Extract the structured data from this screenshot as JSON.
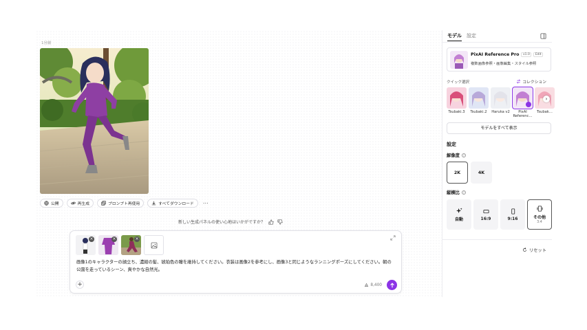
{
  "canvas": {
    "count": "1分前",
    "actions": [
      "公開",
      "再生成",
      "プロンプト再使用",
      "すべてダウンロード"
    ],
    "more": "⋯",
    "feedback": "新しい生成パネルの使い心地はいかがですか？"
  },
  "prompt": {
    "text": "画像1のキャラクターの顔立ち、濃紺の髪、琥珀色の瞳を維持してください。衣装は画像2を参考にし、画像3と同じようなランニングポーズにしてください。朝の公園を走っているシーン、爽やかな自然光。",
    "credits": "8,400",
    "plus": "+"
  },
  "sidebar": {
    "tabs": [
      "モデル",
      "設定"
    ],
    "model": {
      "name": "PixAI Reference Pro",
      "badge1": "v1.0",
      "badge2": "Edit",
      "desc": "複数画像参照・画像編集・スタイル参照"
    },
    "quick_label": "クイック選択",
    "collection": "コレクション",
    "chips": [
      "Tsubaki.3",
      "Tsubaki.2",
      "Haruka v2",
      "PixAI Referenc…",
      "Tsubak…"
    ],
    "show_all": "モデルをすべて表示",
    "settings_title": "設定",
    "resolution_label": "解像度",
    "resolutions": [
      "2K",
      "4K"
    ],
    "ratio_label": "縦横比",
    "ratios": [
      "自動",
      "16:9",
      "9:16",
      "その他"
    ],
    "ratio_sub": "3:4",
    "reset": "リセット"
  },
  "colors": {
    "accent": "#8b34e6"
  }
}
